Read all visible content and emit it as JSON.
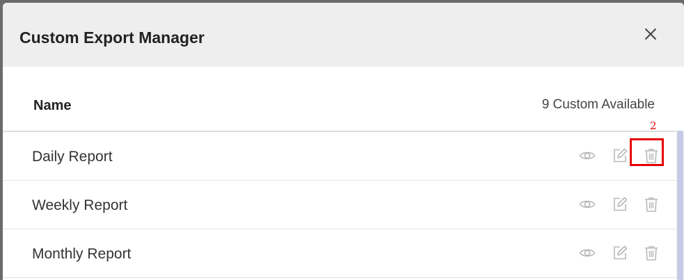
{
  "dialog": {
    "title": "Custom Export Manager"
  },
  "list_header": {
    "name_label": "Name",
    "count_label": "9 Custom Available"
  },
  "rows": [
    {
      "label": "Daily Report"
    },
    {
      "label": "Weekly Report"
    },
    {
      "label": "Monthly Report"
    }
  ],
  "annotation": {
    "label": "2",
    "color": "#e60000"
  },
  "icons": {
    "close": "close-icon",
    "view": "eye-icon",
    "edit": "edit-icon",
    "delete": "trash-icon"
  }
}
